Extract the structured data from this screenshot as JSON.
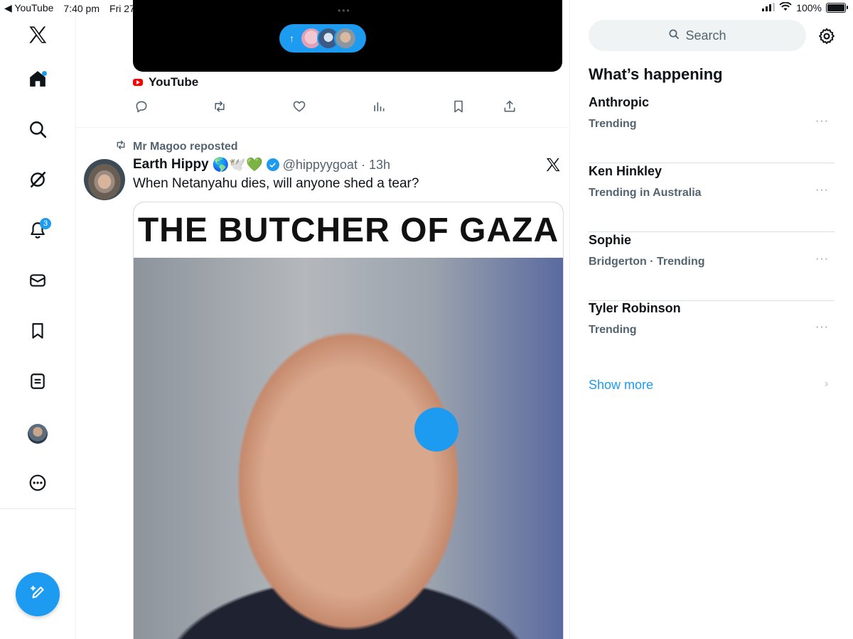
{
  "status_bar": {
    "back_app": "◀ YouTube",
    "time": "7:40 pm",
    "date": "Fri 27",
    "battery": "100%"
  },
  "nav": {
    "notifications_count": "3"
  },
  "feed": {
    "prev_post": {
      "source": "YouTube"
    },
    "post": {
      "repost_label": "Mr Magoo reposted",
      "author": "Earth Hippy",
      "author_emoji": "🌎🕊️💚",
      "handle": "@hippyygoat",
      "time": "· 13h",
      "text": "When Netanyahu dies, will anyone shed a tear?",
      "media_headline": "THE BUTCHER OF GAZA"
    }
  },
  "sidebar": {
    "search_placeholder": "Search",
    "title": "What’s happening",
    "trends": [
      {
        "name": "Anthropic",
        "meta": "Trending"
      },
      {
        "name": "Ken Hinkley",
        "meta": "Trending in Australia"
      },
      {
        "name": "Sophie",
        "meta": "Bridgerton · Trending"
      },
      {
        "name": "Tyler Robinson",
        "meta": "Trending"
      }
    ],
    "show_more": "Show more",
    "more_glyph": "···"
  },
  "colors": {
    "accent": "#1d9bf0",
    "text": "#0f1419",
    "muted": "#536471"
  }
}
